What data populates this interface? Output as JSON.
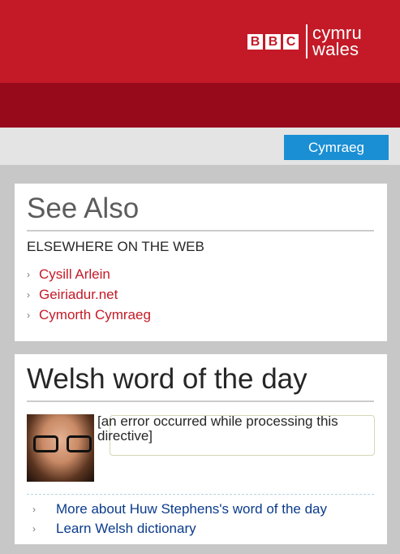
{
  "masthead": {
    "brand_blocks": [
      "B",
      "B",
      "C"
    ],
    "brand_line1": "cymru",
    "brand_line2": "wales"
  },
  "toolbar": {
    "language_button": "Cymraeg"
  },
  "see_also": {
    "title": "See Also",
    "subheading": "ELSEWHERE ON THE WEB",
    "links": [
      "Cysill Arlein",
      "Geiriadur.net",
      "Cymorth Cymraeg"
    ]
  },
  "word_of_day": {
    "title": "Welsh word of the day",
    "message": "[an error occurred while processing this directive]",
    "links": [
      "More about Huw Stephens's word of the day",
      "Learn Welsh dictionary"
    ]
  },
  "colors": {
    "brand_red": "#c41a27",
    "band_dark_red": "#960a1c",
    "button_blue": "#1a8fd4",
    "link_red": "#c41a27",
    "link_blue": "#0b3b8c"
  }
}
